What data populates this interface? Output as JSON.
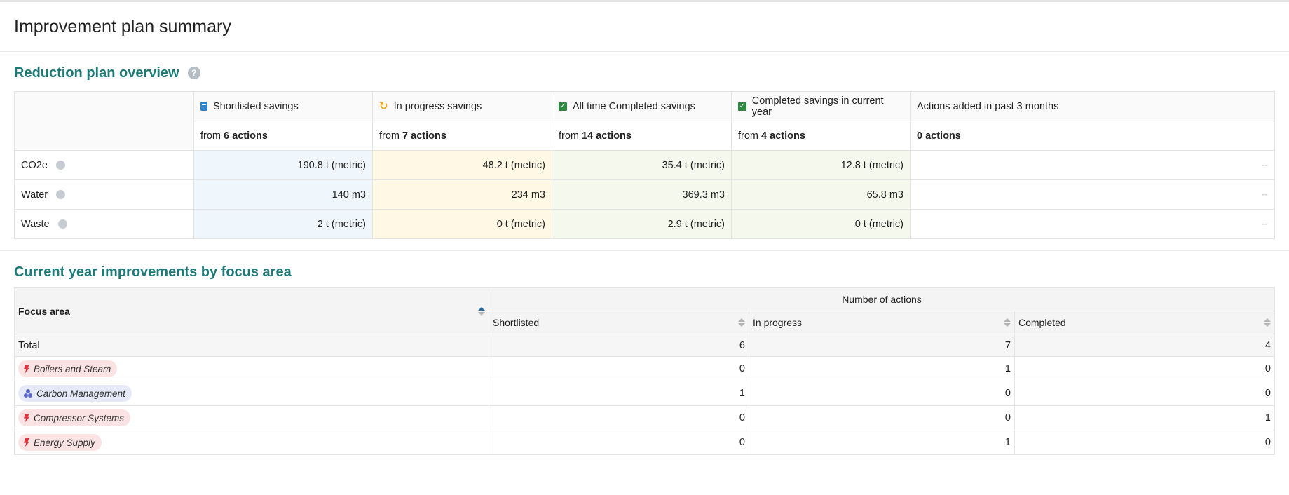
{
  "page": {
    "title": "Improvement plan summary"
  },
  "overview": {
    "title": "Reduction plan overview",
    "help_icon": "?",
    "columns": [
      {
        "label": "Shortlisted savings",
        "icon": "clipboard-icon",
        "from_prefix": "from",
        "from_count": "6 actions"
      },
      {
        "label": "In progress savings",
        "icon": "refresh-icon",
        "from_prefix": "from",
        "from_count": "7 actions"
      },
      {
        "label": "All time Completed savings",
        "icon": "check-icon",
        "from_prefix": "from",
        "from_count": "14 actions"
      },
      {
        "label": "Completed savings in current year",
        "icon": "check-icon",
        "from_prefix": "from",
        "from_count": "4 actions"
      },
      {
        "label": "Actions added in past 3 months",
        "icon": "",
        "from_prefix": "",
        "from_count": "0 actions"
      }
    ],
    "rows": [
      {
        "label": "CO2e",
        "values": [
          "190.8 t (metric)",
          "48.2 t (metric)",
          "35.4 t (metric)",
          "12.8 t (metric)",
          "--"
        ]
      },
      {
        "label": "Water",
        "values": [
          "140 m3",
          "234 m3",
          "369.3 m3",
          "65.8 m3",
          "--"
        ]
      },
      {
        "label": "Waste",
        "values": [
          "2 t (metric)",
          "0 t (metric)",
          "2.9 t (metric)",
          "0 t (metric)",
          "--"
        ]
      }
    ],
    "colors": {
      "shortlisted": "#f0f7fc",
      "in_progress": "#fef8e4",
      "completed": "#f5f9ed",
      "accent": "#1e7a78"
    }
  },
  "focus": {
    "title": "Current year improvements by focus area",
    "col_focus": "Focus area",
    "col_group": "Number of actions",
    "col_shortlisted": "Shortlisted",
    "col_in_progress": "In progress",
    "col_completed": "Completed",
    "total": {
      "label": "Total",
      "shortlisted": "6",
      "in_progress": "7",
      "completed": "4"
    },
    "rows": [
      {
        "label": "Boilers and Steam",
        "icon": "lightning-icon",
        "shortlisted": "0",
        "in_progress": "1",
        "completed": "0"
      },
      {
        "label": "Carbon Management",
        "icon": "molecule-icon",
        "shortlisted": "1",
        "in_progress": "0",
        "completed": "0"
      },
      {
        "label": "Compressor Systems",
        "icon": "lightning-icon",
        "shortlisted": "0",
        "in_progress": "0",
        "completed": "1"
      },
      {
        "label": "Energy Supply",
        "icon": "lightning-icon",
        "shortlisted": "0",
        "in_progress": "1",
        "completed": "0"
      }
    ]
  }
}
